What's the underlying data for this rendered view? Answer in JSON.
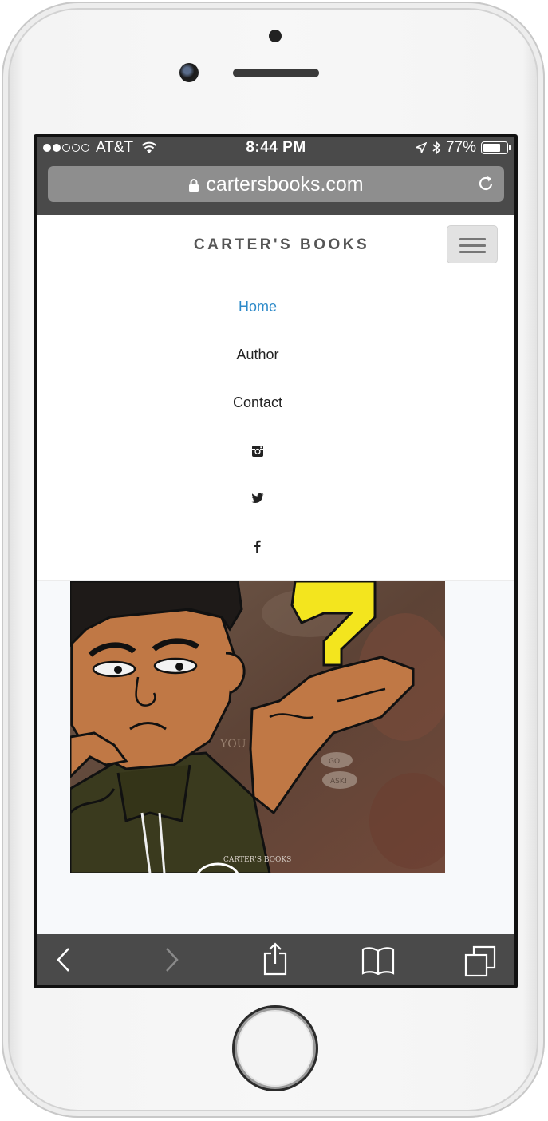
{
  "status_bar": {
    "carrier": "AT&T",
    "time": "8:44 PM",
    "battery_percent": "77%",
    "battery_level": 0.77,
    "signal_dots_filled": 2,
    "signal_dots_total": 5
  },
  "browser": {
    "url": "cartersbooks.com"
  },
  "site": {
    "title": "CARTER'S BOOKS",
    "menu_icon": "hamburger-icon"
  },
  "nav": {
    "items": [
      {
        "label": "Home",
        "active": true
      },
      {
        "label": "Author",
        "active": false
      },
      {
        "label": "Contact",
        "active": false
      }
    ],
    "social_icons": [
      "instagram-icon",
      "twitter-icon",
      "facebook-icon"
    ]
  },
  "hero": {
    "watermark": "CARTER'S BOOKS",
    "bubble_text_1": "GO",
    "bubble_text_2": "ASK!",
    "background_text": "YOU"
  },
  "toolbar": {
    "icons": [
      "back-icon",
      "forward-icon",
      "share-icon",
      "bookmarks-icon",
      "tabs-icon"
    ]
  },
  "colors": {
    "accent": "#2d8ac9",
    "browser_chrome": "#4a4a4a",
    "question_mark": "#f3e51e",
    "skin": "#c07845"
  }
}
